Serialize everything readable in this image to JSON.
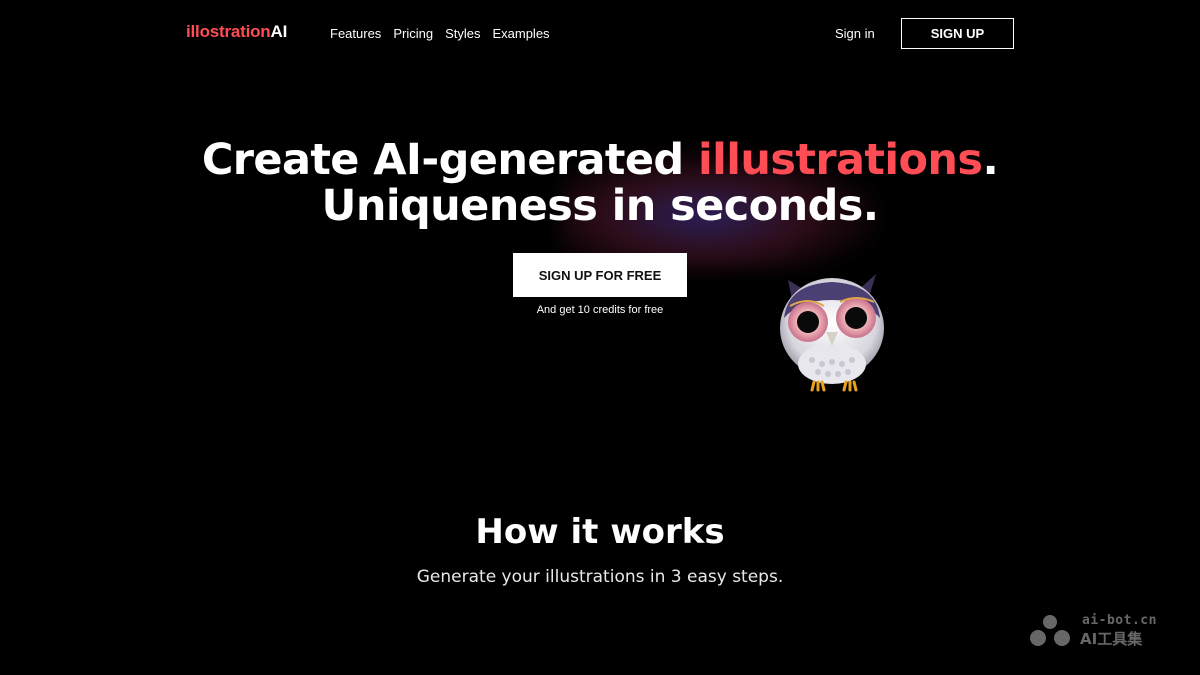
{
  "header": {
    "logo_text": "illostration",
    "logo_suffix": "AI",
    "nav": [
      "Features",
      "Pricing",
      "Styles",
      "Examples"
    ],
    "sign_in": "Sign in",
    "sign_up": "SIGN UP"
  },
  "hero": {
    "title_part1": "Create AI-generated ",
    "title_accent": "illustrations",
    "title_period": ".",
    "title_line2": "Uniqueness in seconds.",
    "cta": "SIGN UP FOR FREE",
    "cta_note": "And get 10 credits for free"
  },
  "how_it_works": {
    "title": "How it works",
    "subtitle": "Generate your illustrations in 3 easy steps."
  },
  "watermark": {
    "url": "ai-bot.cn",
    "name": "AI工具集"
  },
  "colors": {
    "accent": "#ff4d55",
    "background": "#000000",
    "text": "#ffffff"
  },
  "icons": {
    "mascot": "owl-mascot-icon",
    "watermark": "watermark-logo-icon"
  }
}
